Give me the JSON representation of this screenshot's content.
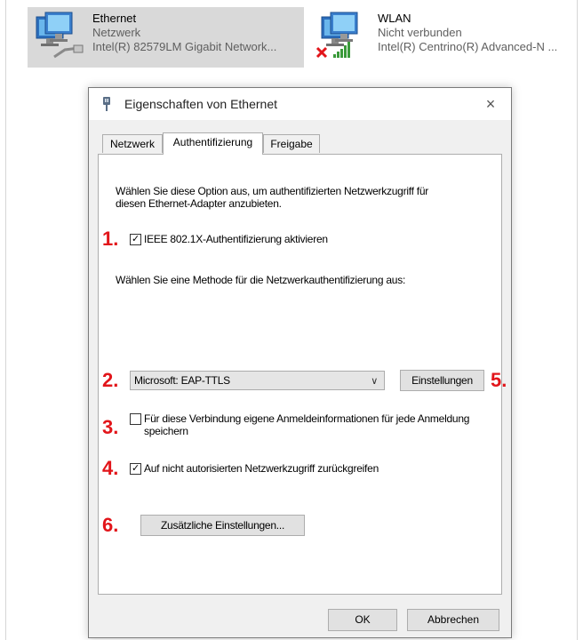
{
  "adapters": [
    {
      "name": "Ethernet",
      "status": "Netzwerk",
      "device": "Intel(R) 82579LM Gigabit Network..."
    },
    {
      "name": "WLAN",
      "status": "Nicht verbunden",
      "device": "Intel(R) Centrino(R) Advanced-N ..."
    }
  ],
  "dialog": {
    "title": "Eigenschaften von Ethernet",
    "close_symbol": "×",
    "tabs": [
      {
        "label": "Netzwerk",
        "active": false
      },
      {
        "label": "Authentifizierung",
        "active": true
      },
      {
        "label": "Freigabe",
        "active": false
      }
    ],
    "intro_text": "Wählen Sie diese Option aus, um authentifizierten Netzwerkzugriff für diesen Ethernet-Adapter anzubieten.",
    "ieee_checkbox": {
      "label": "IEEE 802.1X-Authentifizierung aktivieren",
      "checked": true
    },
    "method_label": "Wählen Sie eine Methode für die Netzwerkauthentifizierung aus:",
    "method_select": {
      "value": "Microsoft: EAP-TTLS"
    },
    "settings_button": "Einstellungen",
    "remember_checkbox": {
      "label": "Für diese Verbindung eigene Anmeldeinformationen für jede Anmeldung speichern",
      "checked": false
    },
    "fallback_checkbox": {
      "label": "Auf nicht autorisierten Netzwerkzugriff zurückgreifen",
      "checked": true
    },
    "additional_button": "Zusätzliche Einstellungen...",
    "ok_button": "OK",
    "cancel_button": "Abbrechen"
  },
  "annotations": [
    "1.",
    "2.",
    "3.",
    "4.",
    "5.",
    "6."
  ],
  "colors": {
    "annotation": "#e2151a",
    "selected_tile": "#d9d9d9",
    "dialog_bg": "#f0f0f0"
  },
  "icons": [
    "network-adapter-icon",
    "network-cable-icon",
    "disconnected-x-icon",
    "wifi-signal-icon",
    "network-plug-icon",
    "close-icon",
    "chevron-down-icon"
  ]
}
